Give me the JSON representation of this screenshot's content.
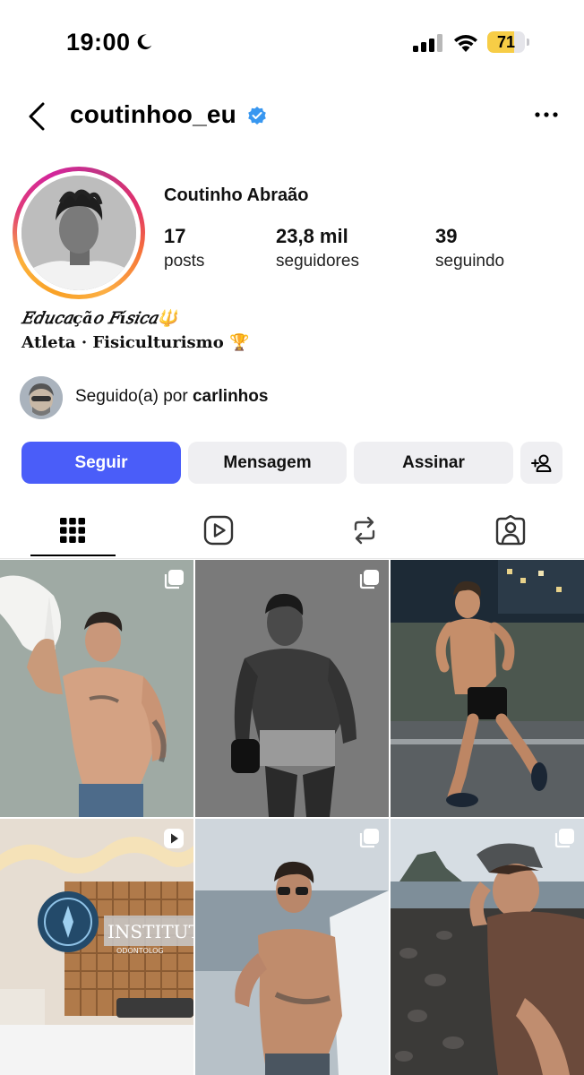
{
  "status_bar": {
    "time": "19:00",
    "battery_level": "71",
    "battery_fraction": 0.71,
    "icons": [
      "moon-icon",
      "cellular-signal-icon",
      "wifi-icon",
      "battery-icon"
    ]
  },
  "header": {
    "username": "coutinhoo_eu",
    "verified": true,
    "icons": [
      "back-chevron-icon",
      "verified-badge-icon",
      "more-options-icon"
    ]
  },
  "profile": {
    "display_name": "Coutinho Abraão",
    "stats": [
      {
        "value": "17",
        "label": "posts"
      },
      {
        "value": "23,8 mil",
        "label": "seguidores"
      },
      {
        "value": "39",
        "label": "seguindo"
      }
    ],
    "bio": {
      "line1": "𝐸𝑑𝑢𝑐𝑎çã𝑜 𝐹í𝑠𝑖𝑐𝑎🔱",
      "line2": "𝐀𝐭𝐥𝐞𝐭𝐚 · 𝐅𝐢𝐬𝐢𝐜𝐮𝐥𝐭𝐮𝐫𝐢𝐬𝐦𝐨 🏆"
    },
    "followed_by": {
      "prefix": "Seguido(a) por",
      "name": "carlinhos"
    }
  },
  "actions": {
    "follow": "Seguir",
    "message": "Mensagem",
    "subscribe": "Assinar",
    "add_person_icon": "add-person-icon",
    "accent_color": "#4a5df9"
  },
  "tabs": [
    {
      "name": "posts-grid",
      "icon": "grid-icon",
      "active": true
    },
    {
      "name": "reels",
      "icon": "reels-icon",
      "active": false
    },
    {
      "name": "reposts",
      "icon": "repost-icon",
      "active": false
    },
    {
      "name": "tagged",
      "icon": "tagged-person-icon",
      "active": false
    }
  ],
  "grid_posts": [
    {
      "badge": "multi-photo-icon"
    },
    {
      "badge": "multi-photo-icon"
    },
    {
      "badge": "none"
    },
    {
      "badge": "reel-play-icon"
    },
    {
      "badge": "multi-photo-icon"
    },
    {
      "badge": "multi-photo-icon"
    }
  ],
  "grid_scene_text": {
    "sign": "INSTITUT",
    "sign_sub": "ODONTOLOG"
  }
}
